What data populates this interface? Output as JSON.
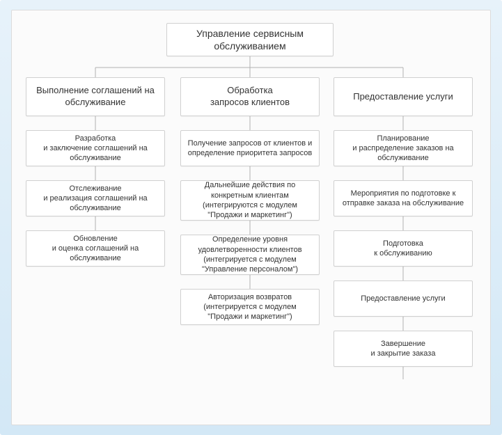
{
  "root": "Управление сервисным обслуживанием",
  "columns": [
    {
      "title": "Выполнение соглашений на обслуживание",
      "items": [
        "Разработка\nи заключение соглашений на обслуживание",
        "Отслеживание\nи реализация соглашений на обслуживание",
        "Обновление\nи оценка соглашений на обслуживание"
      ]
    },
    {
      "title": "Обработка\nзапросов клиентов",
      "items": [
        "Получение запросов от клиентов и определение приоритета запросов",
        "Дальнейшие действия по конкретным клиентам (интегрируются с модулем \"Продажи и маркетинг\")",
        "Определение уровня удовлетворенности клиентов (интегрируется с модулем \"Управление персоналом\")",
        "Авторизация возвратов (интегрируется с модулем \"Продажи и маркетинг\")"
      ]
    },
    {
      "title": "Предоставление услуги",
      "items": [
        "Планирование\nи распределение заказов на обслуживание",
        "Мероприятия по подготовке к отправке заказа на обслуживание",
        "Подготовка\nк обслуживанию",
        "Предоставление услуги",
        "Завершение\nи закрытие заказа"
      ]
    }
  ]
}
